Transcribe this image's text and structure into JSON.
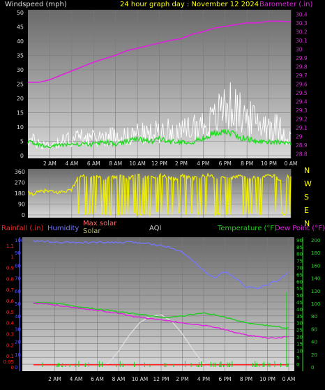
{
  "colors": {
    "background": "#000000",
    "wind": "#dddddd",
    "gust": "#ffffff",
    "wind_avg": "#22dd22",
    "barometer": "#dd22dd",
    "direction": "#eeee00",
    "rain": "#ff2222",
    "humidity": "#7777ff",
    "max_solar": "#dddddd",
    "solar": "#ffff00",
    "aqi": "#cccccc",
    "temperature": "#22cc22",
    "dew_point": "#dd22dd",
    "axis_left_bottom": "#5555ff",
    "axis_right_bottom": "#22dd22",
    "compass": "#ffff00"
  },
  "header": {
    "windspeed": "Windspeed (mph)",
    "title": "24 hour graph day : November 12 2024",
    "barometer": "Barometer (.in)"
  },
  "legend": {
    "rainfall": "Rainfall (.in)",
    "humidity": "Humidity",
    "max_solar": "Max solar",
    "solar": "Solar",
    "aqi": "AQI",
    "temperature": "Temperature (°F)",
    "dew_point": "Dew Point (°F)"
  },
  "compass": [
    "N",
    "W",
    "S",
    "E",
    "N"
  ],
  "chart_data": [
    {
      "type": "line",
      "panel": "wind_barometer",
      "x_ticks": [
        "2 AM",
        "4 AM",
        "6 AM",
        "8 AM",
        "10 AM",
        "12 PM",
        "2 PM",
        "4 PM",
        "6 PM",
        "8 PM",
        "10 PM",
        "0 AM"
      ],
      "y_left_ticks": [
        "0",
        "5",
        "10",
        "15",
        "20",
        "25",
        "30",
        "35",
        "40",
        "45",
        "50"
      ],
      "y_left_range": [
        0,
        50
      ],
      "y_right_ticks": [
        "28.8",
        "28.9",
        "29",
        "29.1",
        "29.2",
        "29.3",
        "29.4",
        "29.5",
        "29.6",
        "29.7",
        "29.8",
        "29.9",
        "30",
        "30.1",
        "30.2",
        "30.3",
        "30.4"
      ],
      "y_right_range": [
        28.75,
        30.45
      ],
      "series": [
        {
          "name": "Barometer (.in)",
          "axis": "right",
          "hours": [
            0,
            1,
            2,
            3,
            4,
            5,
            6,
            7,
            8,
            9,
            10,
            11,
            12,
            13,
            14,
            15,
            16,
            17,
            18,
            19,
            20,
            21,
            22,
            23,
            24
          ],
          "values": [
            29.62,
            29.62,
            29.65,
            29.7,
            29.75,
            29.8,
            29.85,
            29.89,
            29.93,
            29.98,
            30.01,
            30.04,
            30.07,
            30.1,
            30.12,
            30.17,
            30.2,
            30.24,
            30.26,
            30.28,
            30.3,
            30.3,
            30.32,
            30.32,
            30.31
          ]
        },
        {
          "name": "Windspeed (mph)",
          "axis": "left",
          "hours": [
            0,
            1,
            2,
            3,
            4,
            5,
            6,
            7,
            8,
            9,
            10,
            11,
            12,
            13,
            14,
            15,
            16,
            17,
            18,
            19,
            20,
            21,
            22,
            23,
            24
          ],
          "values": [
            5,
            4,
            3,
            4,
            4,
            4,
            4,
            5,
            4,
            5,
            6,
            5,
            6,
            5,
            5,
            5,
            6,
            8,
            9,
            7,
            6,
            5,
            5,
            5,
            4
          ]
        },
        {
          "name": "Wind gust",
          "axis": "left",
          "hours": [
            0,
            1,
            2,
            3,
            4,
            5,
            6,
            7,
            8,
            9,
            10,
            11,
            12,
            13,
            14,
            15,
            16,
            17,
            18,
            19,
            20,
            21,
            22,
            23,
            24
          ],
          "values": [
            8,
            6,
            5,
            7,
            8,
            9,
            8,
            9,
            10,
            9,
            11,
            10,
            12,
            12,
            11,
            14,
            15,
            17,
            25,
            22,
            18,
            16,
            15,
            13,
            8
          ]
        }
      ]
    },
    {
      "type": "scatter",
      "panel": "wind_direction",
      "x_ticks": [],
      "y_ticks": [
        "360",
        "270",
        "180",
        "90",
        "0"
      ],
      "y_range": [
        0,
        360
      ],
      "series": [
        {
          "name": "Wind direction",
          "hours": [
            0,
            0.5,
            1,
            1.5,
            2,
            2.5,
            3,
            3.5,
            4,
            4.5,
            5,
            5.5,
            6,
            6.5,
            7,
            7.5,
            8,
            8.5,
            9,
            9.5,
            10,
            10.5,
            11,
            11.5,
            12,
            12.5,
            13,
            13.5,
            14,
            14.5,
            15,
            15.5,
            16,
            16.5,
            17,
            17.5,
            18,
            18.5,
            19,
            19.5,
            20,
            20.5,
            21,
            21.5,
            22,
            22.5,
            23,
            23.5,
            24
          ],
          "values": [
            180,
            175,
            190,
            200,
            195,
            185,
            190,
            200,
            210,
            300,
            320,
            310,
            330,
            320,
            300,
            330,
            310,
            340,
            300,
            320,
            330,
            310,
            320,
            300,
            330,
            320,
            310,
            300,
            330,
            320,
            310,
            300,
            320,
            330,
            310,
            320,
            300,
            310,
            320,
            330,
            310,
            300,
            320,
            310,
            330,
            320,
            300,
            310,
            320
          ]
        }
      ]
    },
    {
      "type": "line",
      "panel": "rain_humidity_temp",
      "x_ticks": [
        "2 AM",
        "4 AM",
        "6 AM",
        "8 AM",
        "10 AM",
        "12 PM",
        "2 PM",
        "4 PM",
        "6 PM",
        "8 PM",
        "10 PM",
        "0 AM"
      ],
      "y_rain_ticks": [
        "0",
        "0.05",
        "0.1",
        "0.2",
        "0.3",
        "0.4",
        "0.5",
        "0.6",
        "0.7",
        "0.8",
        "0.9",
        "1",
        "1.1"
      ],
      "y_rain_range": [
        0,
        1.15
      ],
      "y_humidity_ticks": [
        "0",
        "10",
        "20",
        "30",
        "40",
        "50",
        "60",
        "70",
        "80",
        "90",
        "100"
      ],
      "y_humidity_range": [
        0,
        100
      ],
      "y_temp_ticks": [
        "0",
        "5",
        "10",
        "15",
        "20",
        "25",
        "30",
        "35",
        "40",
        "45",
        "50",
        "55",
        "60",
        "65",
        "70",
        "75",
        "80",
        "85",
        "90"
      ],
      "y_temp_range": [
        -2,
        92
      ],
      "y_solar_ticks": [
        "0",
        "20",
        "40",
        "60",
        "80",
        "100",
        "120",
        "140",
        "160",
        "180",
        "200"
      ],
      "y_solar_range": [
        0,
        200
      ],
      "series": [
        {
          "name": "Humidity",
          "axis": "humidity",
          "hours": [
            0,
            1,
            2,
            3,
            4,
            5,
            6,
            7,
            8,
            9,
            10,
            11,
            12,
            13,
            14,
            15,
            16,
            17,
            18,
            19,
            20,
            21,
            22,
            23,
            24
          ],
          "values": [
            99,
            99,
            98,
            98,
            98,
            98,
            98,
            98,
            98,
            98,
            98,
            97,
            96,
            94,
            90,
            84,
            76,
            70,
            75,
            70,
            63,
            62,
            65,
            68,
            75
          ]
        },
        {
          "name": "Temperature (°F)",
          "axis": "temp",
          "hours": [
            0,
            1,
            2,
            3,
            4,
            5,
            6,
            7,
            8,
            9,
            10,
            11,
            12,
            13,
            14,
            15,
            16,
            17,
            18,
            19,
            20,
            21,
            22,
            23,
            24
          ],
          "values": [
            44,
            45,
            44,
            43,
            42,
            41,
            40,
            39,
            38,
            37,
            36,
            35,
            34,
            34,
            35,
            36,
            37,
            36,
            34,
            32,
            30,
            29,
            28,
            27,
            26
          ]
        },
        {
          "name": "Dew Point (°F)",
          "axis": "temp",
          "hours": [
            0,
            1,
            2,
            3,
            4,
            5,
            6,
            7,
            8,
            9,
            10,
            11,
            12,
            13,
            14,
            15,
            16,
            17,
            18,
            19,
            20,
            21,
            22,
            23,
            24
          ],
          "values": [
            44,
            44,
            43,
            42,
            41,
            40,
            39,
            38,
            37,
            35,
            34,
            33,
            32,
            31,
            30,
            29,
            28,
            27,
            25,
            23,
            21,
            20,
            19,
            19,
            20
          ]
        },
        {
          "name": "Max solar",
          "axis": "solar",
          "hours": [
            6.5,
            7,
            8,
            9,
            10,
            11,
            12,
            13,
            14,
            15,
            16,
            16.5
          ],
          "values": [
            0,
            5,
            25,
            50,
            70,
            80,
            82,
            72,
            52,
            27,
            5,
            0
          ]
        },
        {
          "name": "Rainfall (.in)",
          "axis": "rain",
          "hours": [
            0,
            24
          ],
          "values": [
            0.02,
            0.02
          ]
        }
      ]
    }
  ]
}
